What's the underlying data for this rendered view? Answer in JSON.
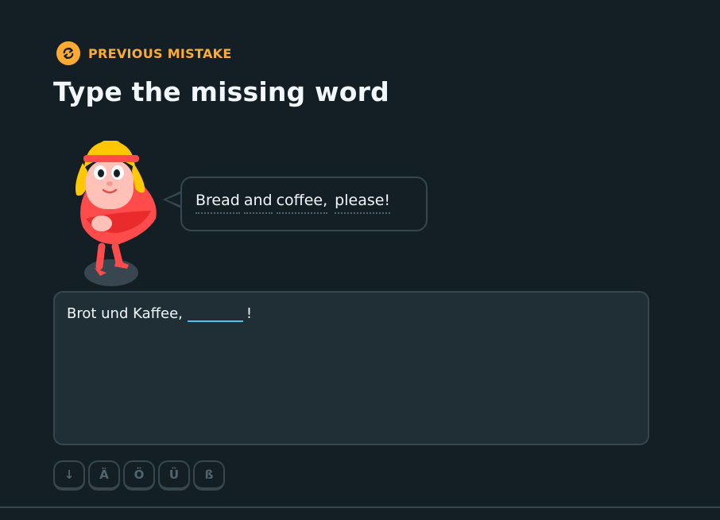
{
  "header": {
    "badge_label": "PREVIOUS MISTAKE",
    "badge_icon": "repeat-icon",
    "title": "Type the missing word"
  },
  "speech_bubble": {
    "words": [
      "Bread",
      "and",
      "coffee,",
      "please!"
    ]
  },
  "exercise": {
    "sentence_prefix": "Brot und Kaffee,",
    "sentence_suffix": "!",
    "answer_value": ""
  },
  "keyboard": {
    "keys": [
      "↓",
      "Ä",
      "Ö",
      "Ü",
      "ß"
    ]
  },
  "colors": {
    "background": "#131f24",
    "accent_orange": "#ffab33",
    "border": "#37464f",
    "input_underline": "#49c0f8",
    "panel": "#202f36"
  }
}
